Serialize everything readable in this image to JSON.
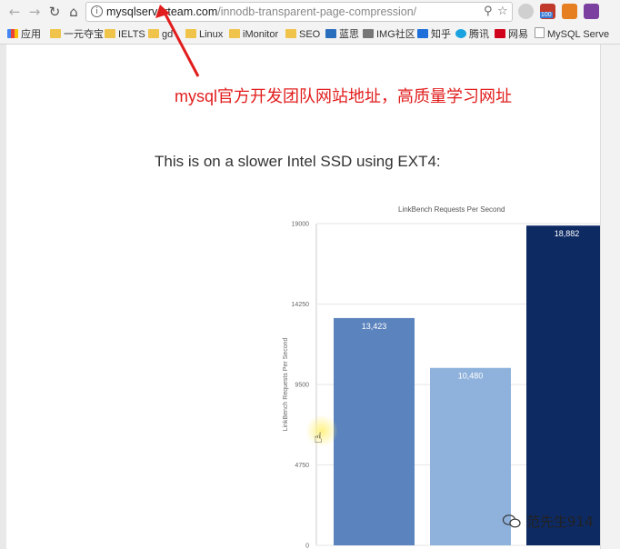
{
  "browser": {
    "url_host": "mysqlserverteam.com",
    "url_path": "/innodb-transparent-page-compression/",
    "bookmarks": [
      {
        "label": "应用",
        "icon": "apps-icon"
      },
      {
        "label": "一元夺宝",
        "icon": "folder-icon"
      },
      {
        "label": "IELTS",
        "icon": "folder-icon"
      },
      {
        "label": "gd",
        "icon": "folder-icon"
      },
      {
        "label": "Linux",
        "icon": "folder-icon"
      },
      {
        "label": "iMonitor",
        "icon": "folder-icon"
      },
      {
        "label": "SEO",
        "icon": "folder-icon"
      },
      {
        "label": "蓝思",
        "icon": "site-icon"
      },
      {
        "label": "IMG社区",
        "icon": "site-icon"
      },
      {
        "label": "知乎",
        "icon": "zhihu-icon"
      },
      {
        "label": "腾讯",
        "icon": "site-icon"
      },
      {
        "label": "网易",
        "icon": "site-icon"
      },
      {
        "label": "MySQL Serve",
        "icon": "page-icon"
      }
    ],
    "extension_badge": "100"
  },
  "annotation": "mysql官方开发团队网站地址，高质量学习网址",
  "heading": "This is on a slower Intel SSD using EXT4:",
  "chart_data": {
    "type": "bar",
    "title": "LinkBench Requests Per Second",
    "ylabel": "LinkBench Requests Per Second",
    "ylim": [
      0,
      19000
    ],
    "yticks": [
      "0",
      "4750",
      "9500",
      "14250",
      "19000"
    ],
    "values": [
      13423,
      10480,
      18882
    ],
    "value_labels": [
      "13,423",
      "10,480",
      "18,882"
    ],
    "colors": [
      "#5b83bd",
      "#8fb2dc",
      "#0d2a63"
    ]
  },
  "watermark": "范先生914"
}
